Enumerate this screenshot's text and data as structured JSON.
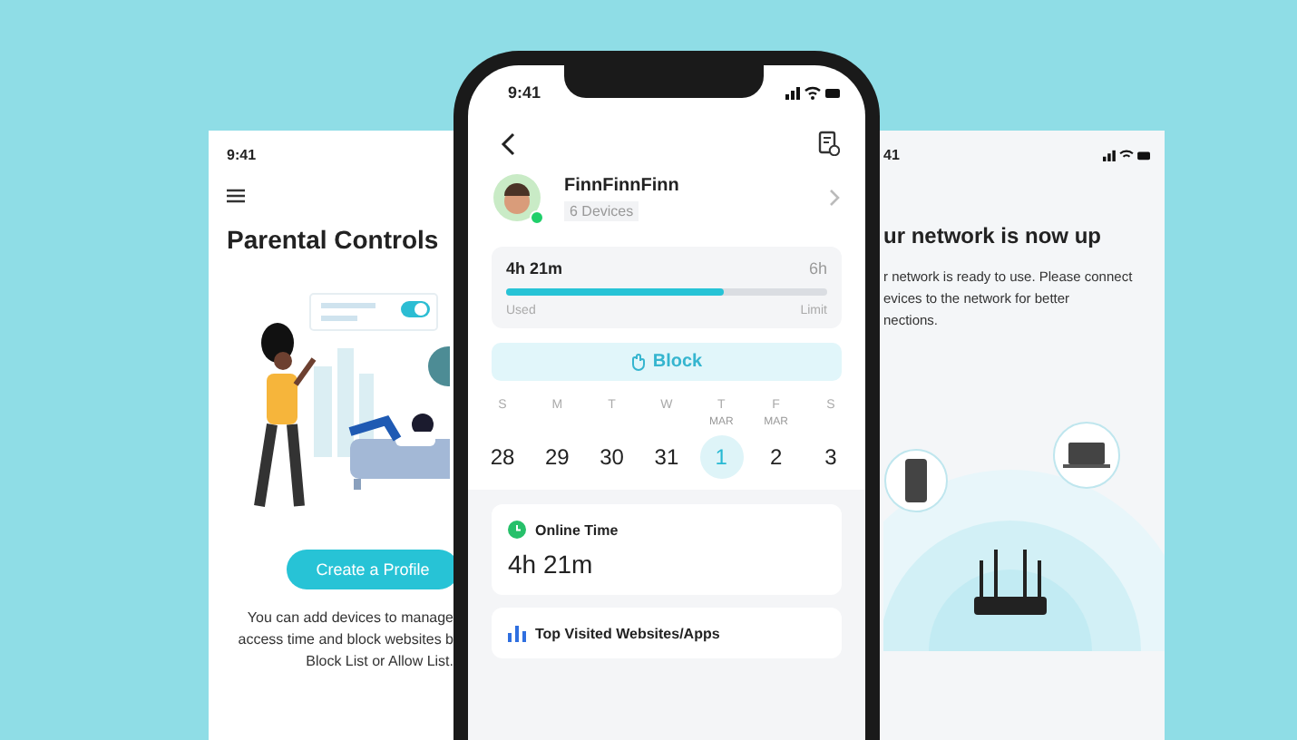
{
  "left_screen": {
    "status_time": "9:41",
    "title": "Parental Controls",
    "button": "Create a Profile",
    "description_lines": [
      "You can add devices to manage",
      "access time and block websites b",
      "Block List or Allow List."
    ]
  },
  "phone": {
    "status_time": "9:41",
    "profile": {
      "name": "FinnFinnFinn",
      "devices": "6 Devices",
      "online": true
    },
    "usage": {
      "used_value": "4h 21m",
      "limit_value": "6h",
      "level": 0.68,
      "used_label": "Used",
      "limit_label": "Limit"
    },
    "block_button": "Block",
    "week": [
      {
        "day": "S",
        "date": "28",
        "selected": false
      },
      {
        "day": "M",
        "date": "29",
        "selected": false
      },
      {
        "day": "T",
        "date": "30",
        "selected": false
      },
      {
        "day": "W",
        "date": "31",
        "selected": false
      },
      {
        "day": "T",
        "month": "MAR",
        "date": "1",
        "selected": true
      },
      {
        "day": "F",
        "month": "MAR",
        "date": "2",
        "selected": false
      },
      {
        "day": "S",
        "date": "3",
        "selected": false
      }
    ],
    "online_time": {
      "title": "Online Time",
      "value": "4h 21m"
    },
    "top_visited": {
      "title": "Top Visited Websites/Apps"
    }
  },
  "right_screen": {
    "status_time": "41",
    "title": "ur network is now up",
    "description_lines": [
      "r network is ready to use. Please connect",
      "evices to the network for better",
      "nections."
    ]
  }
}
